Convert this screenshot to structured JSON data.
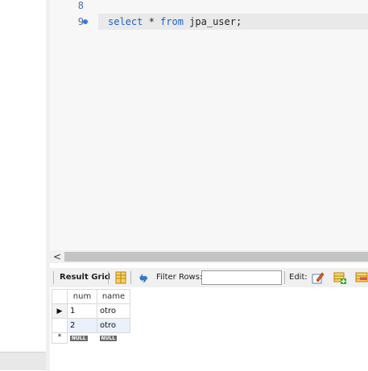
{
  "editor": {
    "lines": [
      {
        "number": "8",
        "text": ""
      },
      {
        "number": "9",
        "code": {
          "kw1": "select",
          "op": " * ",
          "kw2": "from",
          "rest": " jpa_user;"
        }
      }
    ]
  },
  "scrollbar": {
    "left_arrow": "<"
  },
  "toolbar": {
    "result_grid_label": "Result Grid",
    "filter_rows_label": "Filter Rows:",
    "filter_rows_value": "",
    "edit_label": "Edit:"
  },
  "result_grid": {
    "columns": [
      "num",
      "name"
    ],
    "rows": [
      {
        "num": "1",
        "name": "otro"
      },
      {
        "num": "2",
        "name": "otro"
      }
    ],
    "new_row": {
      "num": "NULL",
      "name": "NULL"
    },
    "current_row_marker": "▶",
    "new_row_marker": "*"
  },
  "colors": {
    "keyword": "#1a62c4",
    "line_number": "#4a6fa5",
    "breakpoint_dot": "#2f7ed8"
  }
}
